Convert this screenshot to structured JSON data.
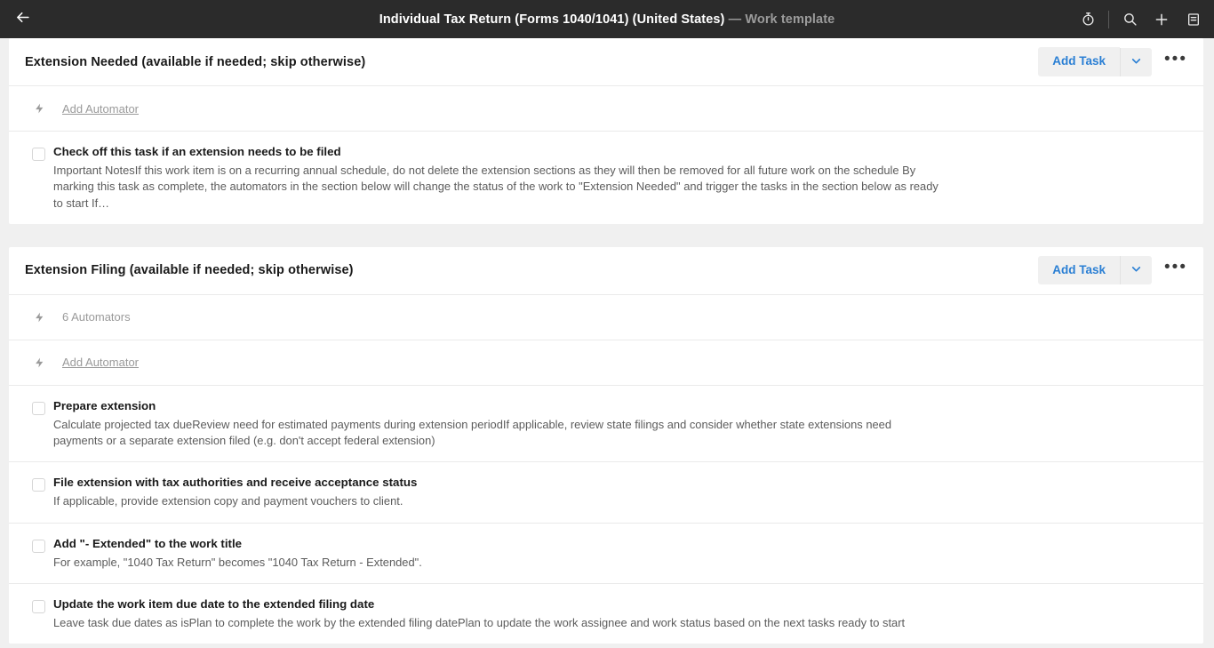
{
  "topbar": {
    "back_icon": "arrow-left-icon",
    "title": "Individual Tax Return (Forms 1040/1041) (United States)",
    "subtitle": "— Work template",
    "icons": [
      "timer-icon",
      "search-icon",
      "plus-icon",
      "notes-icon"
    ],
    "background": "#2b2b2b",
    "title_color": "#ffffff",
    "subtitle_color": "#9b9b9b"
  },
  "colors": {
    "accent": "#2a7fd4",
    "page_bg": "#f0f0f0",
    "card_bg": "#ffffff",
    "divider": "#eaeaea",
    "muted_text": "#9a9a9a",
    "body_text": "#5c5c5c"
  },
  "sections": [
    {
      "title": "Extension Needed (available if needed; skip otherwise)",
      "add_task_label": "Add Task",
      "automator_rows": [
        {
          "label": "Add Automator",
          "link": true
        }
      ],
      "tasks": [
        {
          "title": "Check off this task if an extension needs to be filed",
          "description": "Important NotesIf this work item is on a recurring annual schedule, do not delete the extension sections as they will then be removed for all future work on the schedule By marking this task as complete, the automators in the section below will change the status of the work to \"Extension Needed\" and trigger the tasks in the section below as ready to start If…"
        }
      ]
    },
    {
      "title": "Extension Filing (available if needed; skip otherwise)",
      "add_task_label": "Add Task",
      "automator_rows": [
        {
          "label": "6 Automators",
          "link": false
        },
        {
          "label": "Add Automator",
          "link": true
        }
      ],
      "tasks": [
        {
          "title": "Prepare extension",
          "description": "Calculate projected tax dueReview need for estimated payments during extension periodIf applicable, review state filings and consider whether state extensions need payments or a separate extension filed (e.g. don't accept federal extension)"
        },
        {
          "title": "File extension with tax authorities and receive acceptance status",
          "description": "If applicable, provide extension copy and payment vouchers to client."
        },
        {
          "title": "Add \"- Extended\" to the work title",
          "description": "For example, \"1040 Tax Return\" becomes \"1040 Tax Return - Extended\"."
        },
        {
          "title": "Update the work item due date to the extended filing date",
          "description": "Leave task due dates as isPlan to complete the work by the extended filing datePlan to update the work assignee and work status based on the next tasks ready to start"
        }
      ]
    }
  ]
}
